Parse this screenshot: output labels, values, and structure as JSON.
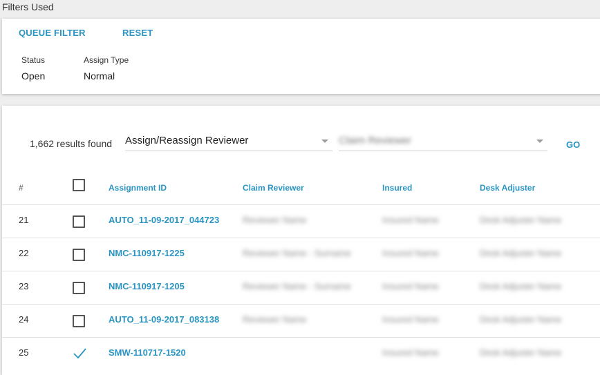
{
  "filters": {
    "heading": "Filters Used",
    "queue_filter_label": "QUEUE FILTER",
    "reset_label": "RESET",
    "items": [
      {
        "label": "Status",
        "value": "Open"
      },
      {
        "label": "Assign Type",
        "value": "Normal"
      }
    ]
  },
  "results": {
    "count_text": "1,662 results found",
    "action_select": "Assign/Reassign Reviewer",
    "reviewer_select": "Claim Reviewer",
    "go_label": "GO",
    "columns": {
      "num": "#",
      "assignment_id": "Assignment ID",
      "claim_reviewer": "Claim Reviewer",
      "insured": "Insured",
      "desk_adjuster": "Desk Adjuster"
    },
    "rows": [
      {
        "num": "21",
        "checked": false,
        "assignment_id": "AUTO_11-09-2017_044723",
        "claim_reviewer": "Reviewer Name",
        "insured": "Insured Name",
        "desk_adjuster": "Desk Adjuster Name"
      },
      {
        "num": "22",
        "checked": false,
        "assignment_id": "NMC-110917-1225",
        "claim_reviewer": "Reviewer Name - Surname",
        "insured": "Insured Name",
        "desk_adjuster": "Desk Adjuster Name"
      },
      {
        "num": "23",
        "checked": false,
        "assignment_id": "NMC-110917-1205",
        "claim_reviewer": "Reviewer Name - Surname",
        "insured": "Insured Name",
        "desk_adjuster": "Desk Adjuster Name"
      },
      {
        "num": "24",
        "checked": false,
        "assignment_id": "AUTO_11-09-2017_083138",
        "claim_reviewer": "Reviewer Name",
        "insured": "Insured Name",
        "desk_adjuster": "Desk Adjuster Name"
      },
      {
        "num": "25",
        "checked": true,
        "assignment_id": "SMW-110717-1520",
        "claim_reviewer": "",
        "insured": "Insured Name",
        "desk_adjuster": "Desk Adjuster Name"
      }
    ]
  },
  "colors": {
    "accent": "#2a94c2"
  }
}
